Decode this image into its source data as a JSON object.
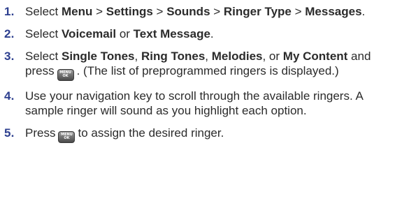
{
  "steps": [
    {
      "number": "1.",
      "parts": [
        {
          "type": "text",
          "text": "Select "
        },
        {
          "type": "bold",
          "text": "Menu"
        },
        {
          "type": "text",
          "text": " > "
        },
        {
          "type": "bold",
          "text": "Settings"
        },
        {
          "type": "text",
          "text": " > "
        },
        {
          "type": "bold",
          "text": "Sounds"
        },
        {
          "type": "text",
          "text": " > "
        },
        {
          "type": "bold",
          "text": "Ringer Type"
        },
        {
          "type": "text",
          "text": " > "
        },
        {
          "type": "bold",
          "text": "Messages"
        },
        {
          "type": "text",
          "text": "."
        }
      ]
    },
    {
      "number": "2.",
      "parts": [
        {
          "type": "text",
          "text": "Select "
        },
        {
          "type": "bold",
          "text": "Voicemail"
        },
        {
          "type": "text",
          "text": " or "
        },
        {
          "type": "bold",
          "text": "Text Message"
        },
        {
          "type": "text",
          "text": "."
        }
      ]
    },
    {
      "number": "3.",
      "parts": [
        {
          "type": "text",
          "text": "Select "
        },
        {
          "type": "bold",
          "text": "Single Tones"
        },
        {
          "type": "text",
          "text": ", "
        },
        {
          "type": "bold",
          "text": "Ring Tones"
        },
        {
          "type": "text",
          "text": ", "
        },
        {
          "type": "bold",
          "text": "Melodies"
        },
        {
          "type": "text",
          "text": ", or "
        },
        {
          "type": "bold",
          "text": "My Content"
        },
        {
          "type": "text",
          "text": " and press"
        },
        {
          "type": "key",
          "icon": "menu-ok-key-icon",
          "line1": "MENU",
          "line2": "OK"
        },
        {
          "type": "text",
          "text": ". (The list of preprogrammed ringers is displayed.)"
        }
      ]
    },
    {
      "number": "4.",
      "parts": [
        {
          "type": "text",
          "text": "Use your navigation key to scroll through the available ringers. A sample ringer will sound as you highlight each option."
        }
      ]
    },
    {
      "number": "5.",
      "parts": [
        {
          "type": "text",
          "text": "Press"
        },
        {
          "type": "key",
          "icon": "menu-ok-key-icon",
          "line1": "MENU",
          "line2": "OK"
        },
        {
          "type": "text",
          "text": "to assign the desired ringer."
        }
      ]
    }
  ],
  "colors": {
    "step_number": "#2d3f8f",
    "body_text": "#2b2b2b"
  }
}
